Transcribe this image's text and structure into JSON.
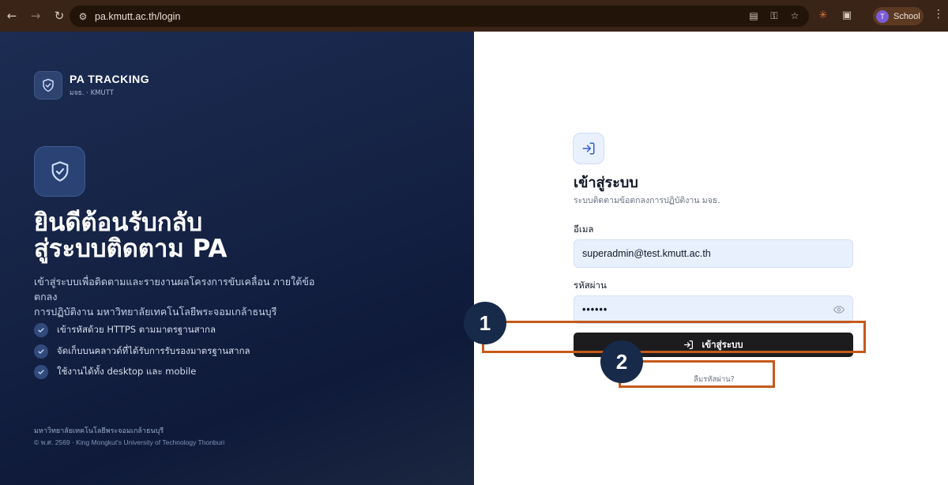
{
  "browser": {
    "url": "pa.kmutt.ac.th/login",
    "profile_initial": "T",
    "profile_name": "School"
  },
  "left_panel": {
    "brand_title": "PA TRACKING",
    "brand_subtitle": "มจธ. · KMUTT",
    "headline_line1": "ยินดีต้อนรับกลับ",
    "headline_line2": "สู่ระบบติดตาม PA",
    "description_line1": "เข้าสู่ระบบเพื่อติดตามและรายงานผลโครงการขับเคลื่อน ภายใต้ข้อตกลง",
    "description_line2": "การปฏิบัติงาน มหาวิทยาลัยเทคโนโลยีพระจอมเกล้าธนบุรี",
    "features": [
      "เข้ารหัสด้วย HTTPS ตามมาตรฐานสากล",
      "จัดเก็บบนคลาวด์ที่ได้รับการรับรองมาตรฐานสากล",
      "ใช้งานได้ทั้ง desktop และ mobile"
    ],
    "footer_university": "มหาวิทยาลัยเทคโนโลยีพระจอมเกล้าธนบุรี",
    "footer_copyright": "© พ.ศ. 2569 · King Mongkut's University of Technology Thonburi"
  },
  "login_form": {
    "title": "เข้าสู่ระบบ",
    "subtitle": "ระบบติดตามข้อตกลงการปฏิบัติงาน มจธ.",
    "email_label": "อีเมล",
    "email_value": "superadmin@test.kmutt.ac.th",
    "password_label": "รหัสผ่าน",
    "password_value": "••••••",
    "submit_label": "เข้าสู่ระบบ",
    "forgot_label": "ลืมรหัสผ่าน?"
  },
  "annotations": {
    "marker1": "1",
    "marker2": "2"
  },
  "colors": {
    "left_bg": "#152244",
    "submit_bg": "#1c1c1f",
    "input_bg": "#e8f0fe",
    "annotation_border": "#c55a1b",
    "annotation_circle": "#172a4a"
  }
}
